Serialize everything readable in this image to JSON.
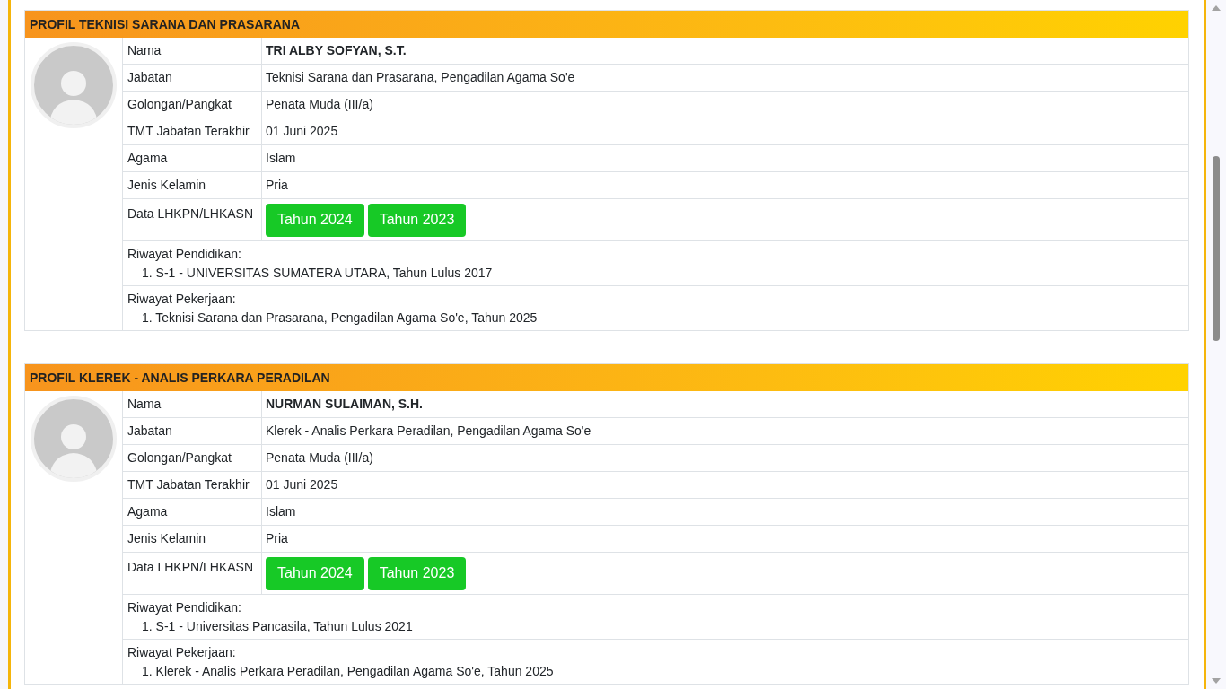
{
  "profiles": [
    {
      "title": "PROFIL TEKNISI SARANA DAN PRASARANA",
      "rows": [
        {
          "kind": "name",
          "label": "Nama",
          "value": "TRI ALBY SOFYAN, S.T."
        },
        {
          "kind": "text",
          "label": "Jabatan",
          "value": "Teknisi Sarana dan Prasarana, Pengadilan Agama So'e"
        },
        {
          "kind": "text",
          "label": "Golongan/Pangkat",
          "value": "Penata Muda (III/a)"
        },
        {
          "kind": "text",
          "label": "TMT Jabatan Terakhir",
          "value": "01 Juni 2025"
        },
        {
          "kind": "text",
          "label": "Agama",
          "value": "Islam"
        },
        {
          "kind": "text",
          "label": "Jenis Kelamin",
          "value": "Pria"
        },
        {
          "kind": "buttons",
          "label": "Data LHKPN/LHKASN",
          "buttons": [
            "Tahun 2024",
            "Tahun 2023"
          ]
        }
      ],
      "histories": [
        {
          "heading": "Riwayat Pendidikan:",
          "items": [
            "1. S-1 - UNIVERSITAS SUMATERA UTARA, Tahun Lulus 2017"
          ]
        },
        {
          "heading": "Riwayat Pekerjaan:",
          "items": [
            "1. Teknisi Sarana dan Prasarana, Pengadilan Agama So'e, Tahun 2025"
          ]
        }
      ]
    },
    {
      "title": "PROFIL KLEREK - ANALIS PERKARA PERADILAN",
      "rows": [
        {
          "kind": "name",
          "label": "Nama",
          "value": "NURMAN SULAIMAN, S.H."
        },
        {
          "kind": "text",
          "label": "Jabatan",
          "value": "Klerek - Analis Perkara Peradilan, Pengadilan Agama So'e"
        },
        {
          "kind": "text",
          "label": "Golongan/Pangkat",
          "value": "Penata Muda (III/a)"
        },
        {
          "kind": "text",
          "label": "TMT Jabatan Terakhir",
          "value": "01 Juni 2025"
        },
        {
          "kind": "text",
          "label": "Agama",
          "value": "Islam"
        },
        {
          "kind": "text",
          "label": "Jenis Kelamin",
          "value": "Pria"
        },
        {
          "kind": "buttons",
          "label": "Data LHKPN/LHKASN",
          "buttons": [
            "Tahun 2024",
            "Tahun 2023"
          ]
        }
      ],
      "histories": [
        {
          "heading": "Riwayat Pendidikan:",
          "items": [
            "1. S-1 - Universitas Pancasila, Tahun Lulus 2021"
          ]
        },
        {
          "heading": "Riwayat Pekerjaan:",
          "items": [
            "1. Klerek - Analis Perkara Peradilan, Pengadilan Agama So'e, Tahun 2025"
          ]
        }
      ]
    }
  ]
}
